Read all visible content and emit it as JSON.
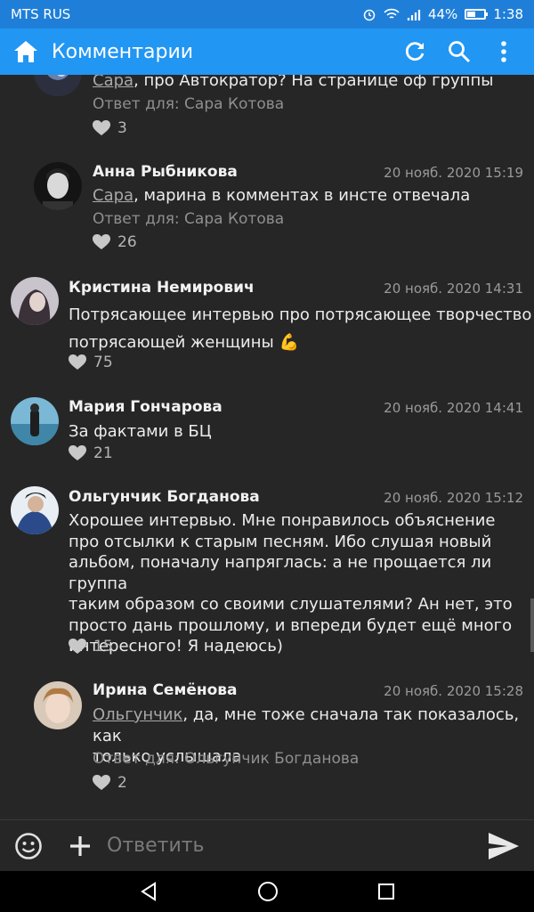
{
  "status_bar": {
    "carrier": "MTS RUS",
    "battery": "44%",
    "time": "1:38"
  },
  "app_bar": {
    "title": "Комментарии",
    "icons": [
      "home-icon",
      "refresh-icon",
      "search-icon",
      "more-vert-icon"
    ]
  },
  "comments": [
    {
      "avatar_icon": "avatar",
      "mention": "Сара",
      "text": ", про Автократор? На странице оф группы",
      "reply_to": "Ответ для: Сара Котова",
      "likes": "3"
    },
    {
      "name": "Анна Рыбникова",
      "time": "20 нояб. 2020 15:19",
      "mention": "Сара",
      "text": ", марина в комментах в инсте отвечала",
      "reply_to": "Ответ для: Сара Котова",
      "likes": "26"
    },
    {
      "name": "Кристина Немирович",
      "time": "20 нояб. 2020 14:31",
      "text_line1": "Потрясающее интервью про потрясающее творчество",
      "text_line2": "потрясающей женщины 💪",
      "likes": "75"
    },
    {
      "name": "Мария Гончарова",
      "time": "20 нояб. 2020 14:41",
      "text": "За фактами в БЦ",
      "likes": "21"
    },
    {
      "name": "Ольгунчик Богданова",
      "time": "20 нояб. 2020 15:12",
      "lines": [
        "Хорошее интервью. Мне понравилось объяснение",
        "про отсылки к старым песням. Ибо слушая новый",
        "альбом, поначалу напряглась: а не прощается ли группа",
        "таким образом со своими слушателями? Ан нет, это",
        "просто дань прошлому, и впереди будет ещё много",
        "интересного! Я надеюсь)"
      ],
      "likes": "15"
    },
    {
      "name": "Ирина Семёнова",
      "time": "20 нояб. 2020 15:28",
      "mention": "Ольгунчик",
      "text_line1": ", да, мне тоже сначала так показалось, как",
      "text_line2": "только услышала",
      "reply_to": "Ответ для: Ольгунчик Богданова",
      "likes": "2"
    }
  ],
  "composer": {
    "placeholder": "Ответить"
  },
  "colors": {
    "appbar": "#2196f3",
    "statusbar": "#1f7fd8",
    "background": "#262626"
  }
}
